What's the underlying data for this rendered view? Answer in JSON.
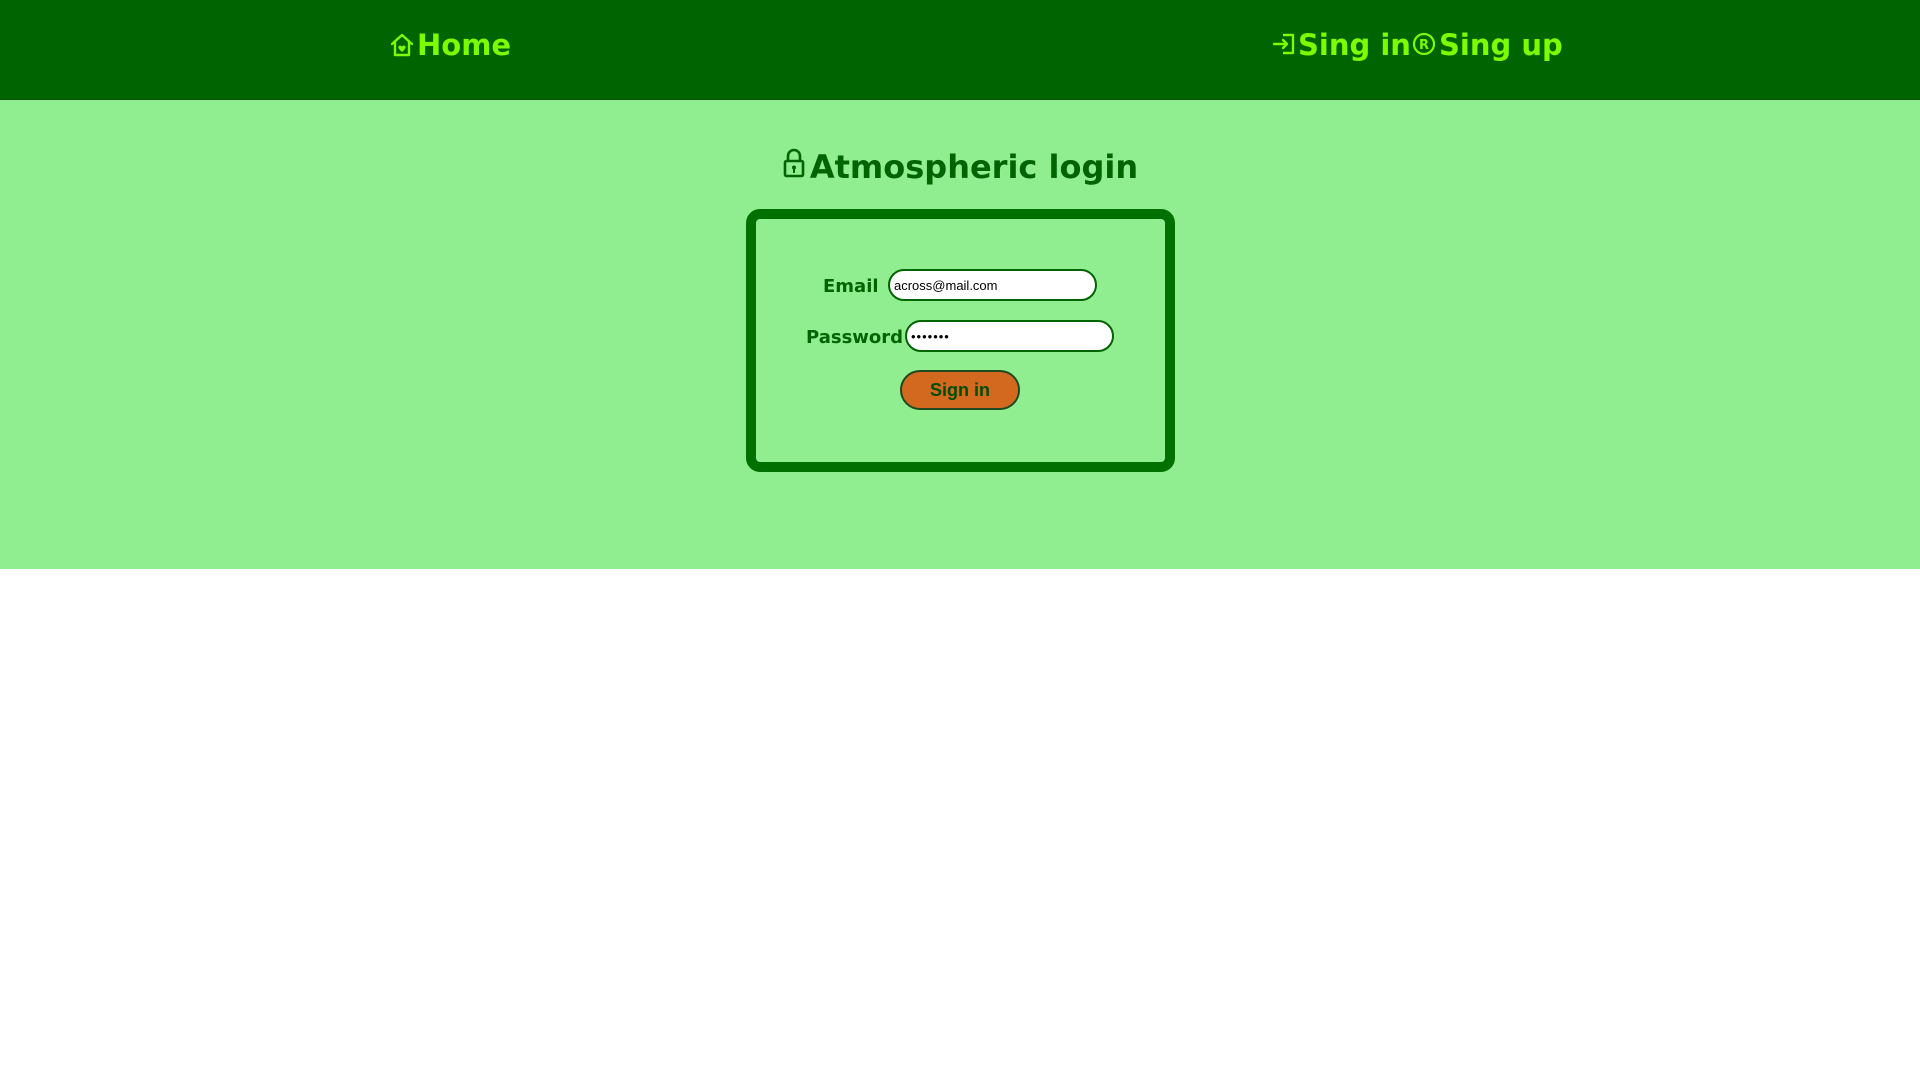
{
  "nav": {
    "home": {
      "label": "Home",
      "icon": "home-icon"
    },
    "signin": {
      "label": "Sing in",
      "icon": "login-icon"
    },
    "signup": {
      "label": "Sing up",
      "icon": "registered-icon"
    }
  },
  "page": {
    "heading": "Atmospheric login",
    "heading_icon": "lock-icon"
  },
  "form": {
    "email_label": "Email",
    "email_value": "across@mail.com",
    "password_label": "Password",
    "password_value": "•••••••",
    "submit_label": "Sign in"
  },
  "colors": {
    "header_bg": "#006400",
    "nav_text": "#7CFC00",
    "main_bg": "#90EE90",
    "panel_border": "#007000",
    "button_bg": "#D2691E"
  }
}
